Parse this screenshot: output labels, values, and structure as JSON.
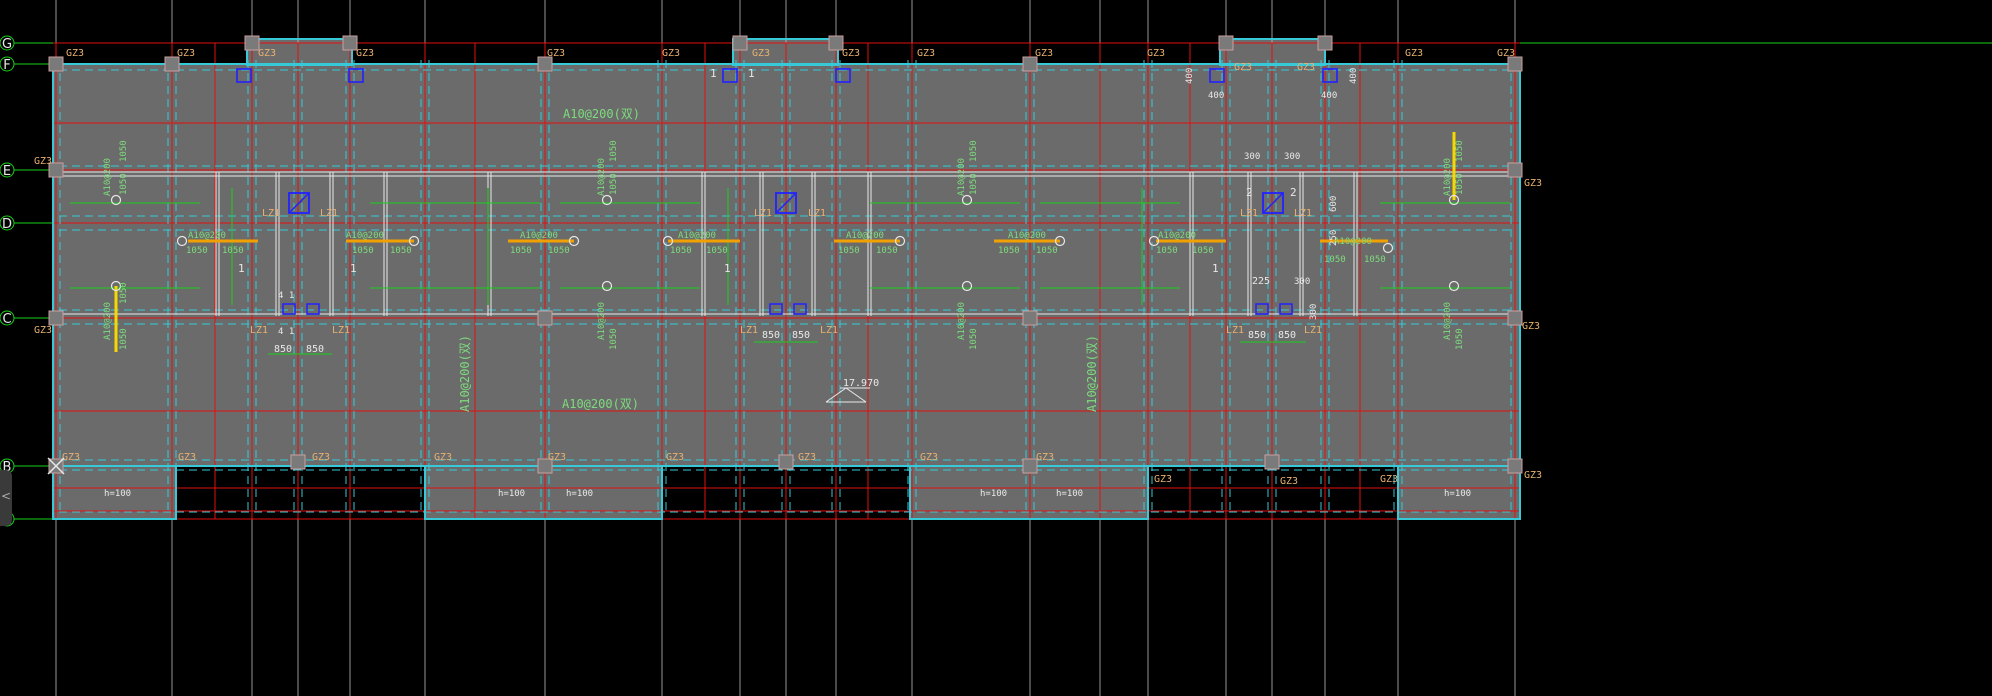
{
  "drawing": {
    "axis_labels": {
      "rows": [
        "G",
        "F",
        "E",
        "D",
        "C",
        "B",
        "A"
      ]
    },
    "column_tag": "GZ3",
    "beam_tag": "LZ1",
    "elevation": "17.970",
    "slab_thickness_tag": "h=100",
    "slab_rebar_double": "A10@200(双)",
    "slab_rebar": "A10@200",
    "dims": {
      "d1050": "1050",
      "d850": "850",
      "d400": "400",
      "d300": "300",
      "d225": "225",
      "d600": "600",
      "d250": "250"
    },
    "marks": {
      "one": "1",
      "two": "2",
      "four_one": "4 1"
    },
    "side_tab_glyph": "<"
  }
}
